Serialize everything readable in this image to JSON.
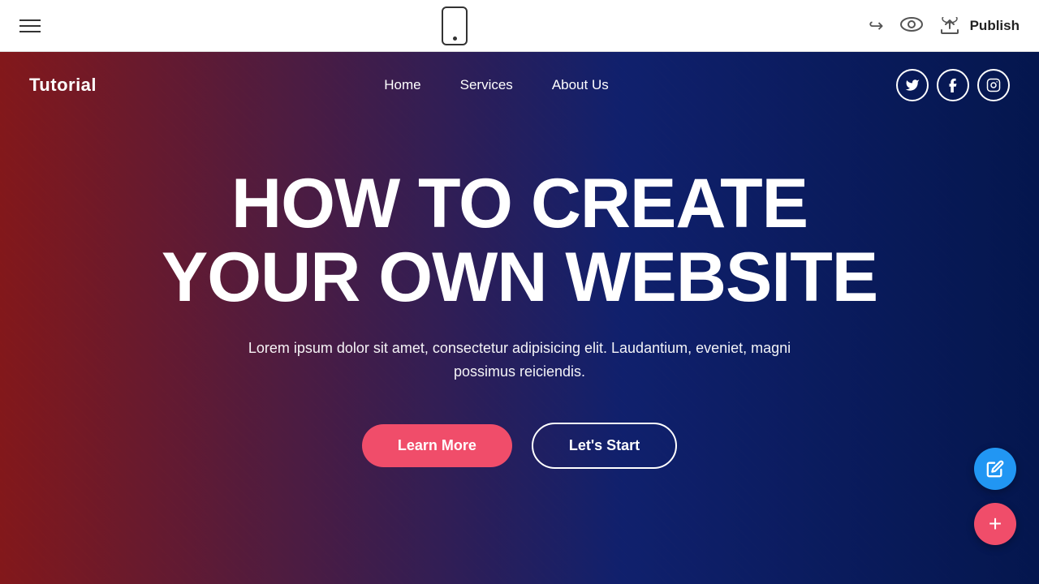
{
  "toolbar": {
    "hamburger_label": "menu",
    "undo_label": "↩",
    "eye_label": "👁",
    "cloud_label": "⬆",
    "publish_label": "Publish"
  },
  "site": {
    "logo": "Tutorial",
    "nav": {
      "links": [
        {
          "label": "Home",
          "id": "home"
        },
        {
          "label": "Services",
          "id": "services"
        },
        {
          "label": "About Us",
          "id": "about"
        }
      ],
      "socials": [
        {
          "label": "t",
          "name": "twitter",
          "symbol": "𝕋"
        },
        {
          "label": "f",
          "name": "facebook",
          "symbol": "f"
        },
        {
          "label": "in",
          "name": "instagram",
          "symbol": "📷"
        }
      ]
    }
  },
  "hero": {
    "title_line1": "HOW TO CREATE",
    "title_line2": "YOUR OWN WEBSITE",
    "subtitle": "Lorem ipsum dolor sit amet, consectetur adipisicing elit. Laudantium, eveniet, magni possimus reiciendis.",
    "btn_learn_more": "Learn More",
    "btn_lets_start": "Let's Start"
  },
  "colors": {
    "accent_red": "#f04d6a",
    "accent_blue": "#2196f3",
    "hero_gradient_left": "rgba(150,20,20,0.82)",
    "hero_gradient_right": "rgba(0,20,80,0.9)"
  }
}
